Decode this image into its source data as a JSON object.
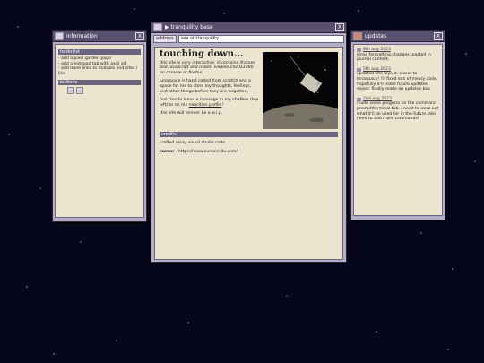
{
  "info_window": {
    "title": "information",
    "close": "X",
    "todo_heading": "to-do list",
    "todo_items": [
      "- add a pixel garden page",
      "- add a notepad tab with ascii art",
      "- add more links to mutuals and sites i like"
    ],
    "buttons_heading": "buttons"
  },
  "main_window": {
    "title": "▶ tranquility base",
    "close": "X",
    "address_label": "address",
    "address_value": "sea of tranquility",
    "heading": "touching down...",
    "intro": "this site is very interactive. it contains iframes and javascript and is best viewed 1920x1080 on chrome or firefox.",
    "para1": "lunaspace is hand coded from scratch and a space for me to store my thoughts, feelings, and other things before they are forgotten.",
    "para2_pre": "feel free to leave a message in my chatbox (top left) or on my",
    "para2_link": "neocities profile",
    "para2_post": "!",
    "para3": "this site will forever be a w.i.p.",
    "credits_heading": "credits",
    "credit1": "crafted using visual studio code",
    "credit2_label": "cursor",
    "credit2_value": "- https://www.cursors-4u.com/"
  },
  "updates_window": {
    "title": "updates",
    "close": "X",
    "entries": [
      {
        "date": "8th aug 2023",
        "text": "small formatting changes. pasted in journal content."
      },
      {
        "date": "5th aug 2023",
        "text": "updated site layout. closer to lunaspace! i'll fixed lots of messy code, hopefully it'll make future updates easier. finally made an updates box"
      },
      {
        "date": "2nd aug 2023",
        "text": "made some progress on the command prompt/terminal tab. i need to work out what it'll be used for in the future, also need to add more commands!"
      }
    ]
  }
}
